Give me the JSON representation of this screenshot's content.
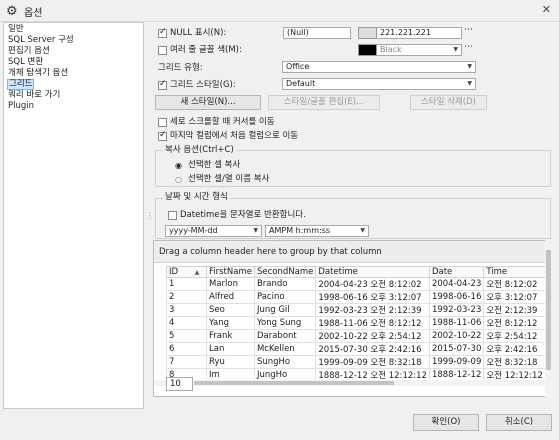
{
  "window": {
    "title": "옵션",
    "close": "✕"
  },
  "nav": {
    "items": [
      "일반",
      "SQL Server 구성",
      "편집기 옵션",
      "SQL 변환",
      "개체 탐색기 옵션",
      "그리드",
      "쿼리 바로 가기",
      "Plugin"
    ],
    "selected_index": 5
  },
  "null_display": {
    "label": "NULL 표시(N):",
    "checked": true,
    "value": "(Null)",
    "color_text": "221.221.221",
    "color_hex": "#dddddd"
  },
  "alt_row": {
    "label": "여러 줄 글꼴 색(M):",
    "checked": false,
    "color_text": "Black",
    "color_hex": "#000000"
  },
  "grid_type": {
    "label": "그리드 유형:",
    "value": "Office"
  },
  "grid_style": {
    "label": "그리드 스타일(G):",
    "checked": true,
    "value": "Default"
  },
  "style_buttons": {
    "new": "새 스타일(N)...",
    "edit": "스타일/글꼴 편집(E)...",
    "delete": "스타일 삭제(D)"
  },
  "options": {
    "scroll_cursor": {
      "label": "세로 스크롤할 때 커서를 이동",
      "checked": false
    },
    "last_to_first": {
      "label": "마지막 컬럼에서 처음 컬럼으로 이동",
      "checked": true
    }
  },
  "copy_options": {
    "title": "복사 옵션(Ctrl+C)",
    "choices": [
      {
        "label": "선택한 셀 복사",
        "selected": true
      },
      {
        "label": "선택한 셀/열 이름 복사",
        "selected": false
      }
    ]
  },
  "datetime": {
    "title": "날짜 및 시간 형식",
    "as_string_label": "Datetime을 문자열로 반환합니다.",
    "as_string_checked": false,
    "date_format": "yyyy-MM-dd",
    "time_format": "AMPM h:mm:ss"
  },
  "preview": {
    "group_hint": "Drag a column header here to group by that column",
    "columns": [
      "ID",
      "FirstName",
      "SecondName",
      "Datetime",
      "Date",
      "Time"
    ],
    "rows": [
      [
        "1",
        "Marlon",
        "Brando",
        "2004-04-23 오전 8:12:02",
        "2004-04-23",
        "오전 8:12:02"
      ],
      [
        "2",
        "Alfred",
        "Pacino",
        "1998-06-16 오후 3:12:07",
        "1998-06-16",
        "오후 3:12:07"
      ],
      [
        "3",
        "Seo",
        "Jung Gil",
        "1992-03-23 오전 2:12:39",
        "1992-03-23",
        "오전 2:12:39"
      ],
      [
        "4",
        "Yang",
        "Yong Sung",
        "1988-11-06 오전 8:12:12",
        "1988-11-06",
        "오전 8:12:12"
      ],
      [
        "5",
        "Frank",
        "Darabont",
        "2002-10-22 오후 2:54:12",
        "2002-10-22",
        "오후 2:54:12"
      ],
      [
        "6",
        "Lan",
        "McKellen",
        "2015-07-30 오후 2:42:16",
        "2015-07-30",
        "오후 2:42:16"
      ],
      [
        "7",
        "Ryu",
        "SungHo",
        "1999-09-09 오전 8:32:18",
        "1999-09-09",
        "오전 8:32:18"
      ],
      [
        "8",
        "Im",
        "JungHo",
        "1888-12-12 오전 12:12:12",
        "1888-12-12",
        "오전 12:12:12"
      ]
    ],
    "page_size": "10"
  },
  "footer": {
    "ok": "확인(O)",
    "cancel": "취소(C)"
  }
}
